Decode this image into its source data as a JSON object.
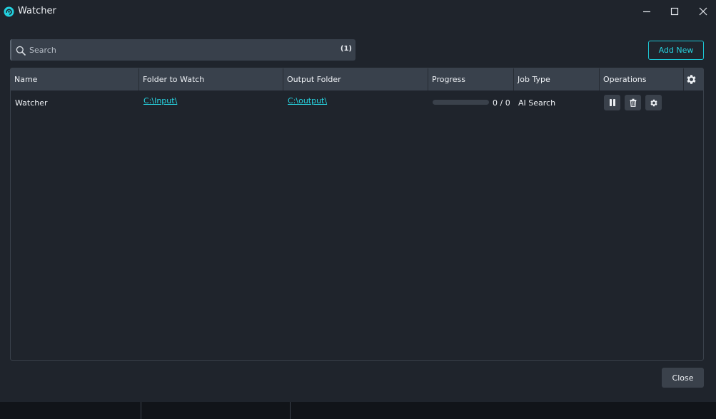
{
  "window": {
    "title": "Watcher",
    "icons": {
      "app": "watcher-logo-icon",
      "minimize": "minimize-icon",
      "maximize": "maximize-icon",
      "close": "close-icon"
    }
  },
  "search": {
    "placeholder": "Search",
    "value": "",
    "count": "(1)"
  },
  "toolbar": {
    "add_new_label": "Add New"
  },
  "table": {
    "columns": [
      "Name",
      "Folder to Watch",
      "Output Folder",
      "Progress",
      "Job Type",
      "Operations"
    ],
    "rows": [
      {
        "name": "Watcher",
        "folder_to_watch": "C:\\Input\\",
        "output_folder": "C:\\output\\",
        "progress_text": "0 / 0",
        "progress_fraction": 0,
        "job_type": "AI Search",
        "operations": [
          "pause-icon",
          "trash-icon",
          "gear-icon"
        ]
      }
    ]
  },
  "footer": {
    "close_label": "Close"
  },
  "colors": {
    "accent": "#27d3e0",
    "window_bg": "#1f242c",
    "header_bg": "#39414c",
    "button_bg": "#3a414b"
  }
}
